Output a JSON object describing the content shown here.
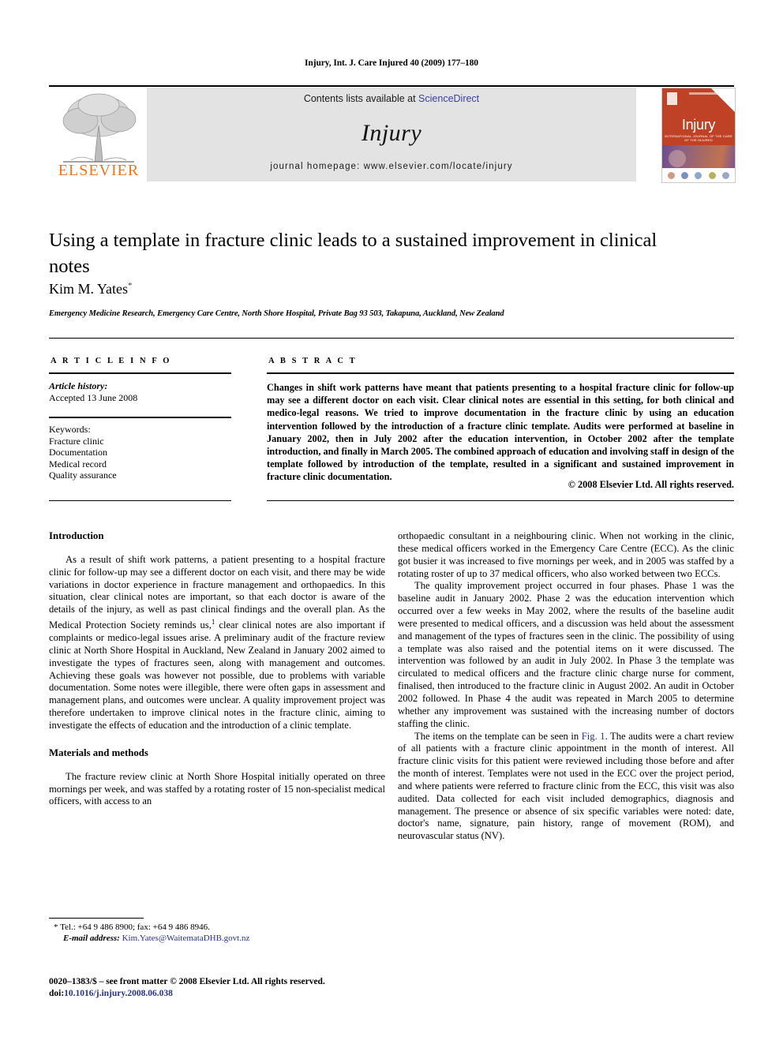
{
  "running_head": "Injury, Int. J. Care Injured 40 (2009) 177–180",
  "journal_header": {
    "contents_prefix": "Contents lists available at ",
    "sciencedirect": "ScienceDirect",
    "journal_name": "Injury",
    "homepage": "journal homepage: www.elsevier.com/locate/injury",
    "publisher_logo_text": "ELSEVIER",
    "publisher_logo_color": "#e87722",
    "sciencedirect_color": "#3b3fa8",
    "cover": {
      "title": "Injury",
      "subtitle": "INTERNATIONAL JOURNAL OF THE CARE OF THE INJURED",
      "accent_color": "#bf4226"
    }
  },
  "article": {
    "title": "Using a template in fracture clinic leads to a sustained improvement in clinical notes",
    "author": "Kim M. Yates",
    "author_marker": "*",
    "affiliation": "Emergency Medicine Research, Emergency Care Centre, North Shore Hospital, Private Bag 93 503, Takapuna, Auckland, New Zealand"
  },
  "article_info": {
    "heading": "A R T I C L E  I N F O",
    "history_label": "Article history:",
    "history_value": "Accepted 13 June 2008",
    "keywords_label": "Keywords:",
    "keywords": [
      "Fracture clinic",
      "Documentation",
      "Medical record",
      "Quality assurance"
    ]
  },
  "abstract": {
    "heading": "A B S T R A C T",
    "text": "Changes in shift work patterns have meant that patients presenting to a hospital fracture clinic for follow-up may see a different doctor on each visit. Clear clinical notes are essential in this setting, for both clinical and medico-legal reasons. We tried to improve documentation in the fracture clinic by using an education intervention followed by the introduction of a fracture clinic template. Audits were performed at baseline in January 2002, then in July 2002 after the education intervention, in October 2002 after the template introduction, and finally in March 2005. The combined approach of education and involving staff in design of the template followed by introduction of the template, resulted in a significant and sustained improvement in fracture clinic documentation.",
    "copyright": "© 2008 Elsevier Ltd. All rights reserved."
  },
  "body": {
    "left": {
      "introduction_heading": "Introduction",
      "introduction_p1": "As a result of shift work patterns, a patient presenting to a hospital fracture clinic for follow-up may see a different doctor on each visit, and there may be wide variations in doctor experience in fracture management and orthopaedics. In this situation, clear clinical notes are important, so that each doctor is aware of the details of the injury, as well as past clinical findings and the overall plan. As the Medical Protection Society reminds us,",
      "introduction_ref": "1",
      "introduction_p1_cont": " clear clinical notes are also important if complaints or medico-legal issues arise. A preliminary audit of the fracture review clinic at North Shore Hospital in Auckland, New Zealand in January 2002 aimed to investigate the types of fractures seen, along with management and outcomes. Achieving these goals was however not possible, due to problems with variable documentation. Some notes were illegible, there were often gaps in assessment and management plans, and outcomes were unclear. A quality improvement project was therefore undertaken to improve clinical notes in the fracture clinic, aiming to investigate the effects of education and the introduction of a clinic template.",
      "methods_heading": "Materials and methods",
      "methods_p1": "The fracture review clinic at North Shore Hospital initially operated on three mornings per week, and was staffed by a rotating roster of 15 non-specialist medical officers, with access to an"
    },
    "right": {
      "p_cont": "orthopaedic consultant in a neighbouring clinic. When not working in the clinic, these medical officers worked in the Emergency Care Centre (ECC). As the clinic got busier it was increased to five mornings per week, and in 2005 was staffed by a rotating roster of up to 37 medical officers, who also worked between two ECCs.",
      "p2": "The quality improvement project occurred in four phases. Phase 1 was the baseline audit in January 2002. Phase 2 was the education intervention which occurred over a few weeks in May 2002, where the results of the baseline audit were presented to medical officers, and a discussion was held about the assessment and management of the types of fractures seen in the clinic. The possibility of using a template was also raised and the potential items on it were discussed. The intervention was followed by an audit in July 2002. In Phase 3 the template was circulated to medical officers and the fracture clinic charge nurse for comment, finalised, then introduced to the fracture clinic in August 2002. An audit in October 2002 followed. In Phase 4 the audit was repeated in March 2005 to determine whether any improvement was sustained with the increasing number of doctors staffing the clinic.",
      "p3_pre": "The items on the template can be seen in ",
      "p3_figref": "Fig. 1",
      "p3_post": ". The audits were a chart review of all patients with a fracture clinic appointment in the month of interest. All fracture clinic visits for this patient were reviewed including those before and after the month of interest. Templates were not used in the ECC over the project period, and where patients were referred to fracture clinic from the ECC, this visit was also audited. Data collected for each visit included demographics, diagnosis and management. The presence or absence of six specific variables were noted: date, doctor's name, signature, pain history, range of movement (ROM), and neurovascular status (NV)."
    }
  },
  "footnotes": {
    "marker": "*",
    "tel": "Tel.: +64 9 486 8900; fax: +64 9 486 8946.",
    "email_label": "E-mail address:",
    "email": "Kim.Yates@WaitemataDHB.govt.nz",
    "email_color": "#26348b"
  },
  "colophon": {
    "issn_line": "0020–1383/$ – see front matter © 2008 Elsevier Ltd. All rights reserved.",
    "doi_label": "doi:",
    "doi": "10.1016/j.injury.2008.06.038"
  }
}
